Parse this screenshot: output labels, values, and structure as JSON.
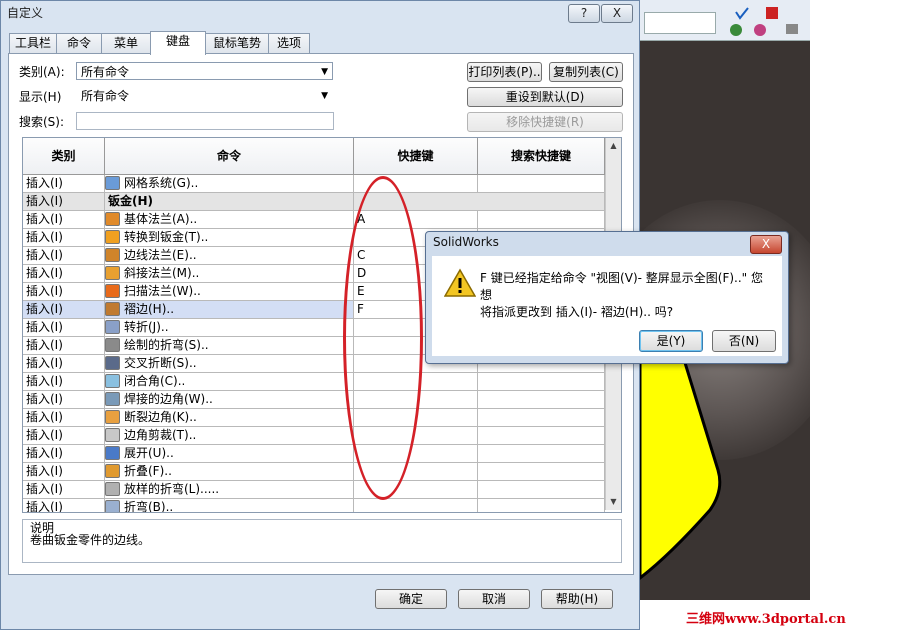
{
  "dialog": {
    "title": "自定义",
    "help_button": "?",
    "close_button": "X",
    "tabs": [
      {
        "label": "工具栏"
      },
      {
        "label": "命令"
      },
      {
        "label": "菜单"
      },
      {
        "label": "键盘"
      },
      {
        "label": "鼠标笔势"
      },
      {
        "label": "选项"
      }
    ],
    "active_tab": "键盘",
    "category_label": "类别(A):",
    "category_value": "所有命令",
    "show_label": "显示(H)",
    "show_value": "所有命令",
    "search_label": "搜索(S):",
    "search_value": "",
    "print_list_button": "打印列表(P)..",
    "copy_list_button": "复制列表(C)",
    "reset_default_button": "重设到默认(D)",
    "remove_shortcut_button": "移除快捷键(R)",
    "columns": [
      "类别",
      "命令",
      "快捷键",
      "搜索快捷键"
    ],
    "rows": [
      {
        "category": "插入(I)",
        "command": "网格系统(G)..",
        "shortcut": "",
        "group": false
      },
      {
        "category": "插入(I)",
        "command": "钣金(H)",
        "shortcut": "",
        "group": true
      },
      {
        "category": "插入(I)",
        "command": "基体法兰(A)..",
        "shortcut": "A",
        "group": false
      },
      {
        "category": "插入(I)",
        "command": "转换到钣金(T)..",
        "shortcut": "",
        "group": false
      },
      {
        "category": "插入(I)",
        "command": "边线法兰(E)..",
        "shortcut": "C",
        "group": false
      },
      {
        "category": "插入(I)",
        "command": "斜接法兰(M)..",
        "shortcut": "D",
        "group": false
      },
      {
        "category": "插入(I)",
        "command": "扫描法兰(W)..",
        "shortcut": "E",
        "group": false
      },
      {
        "category": "插入(I)",
        "command": "褶边(H)..",
        "shortcut": "F",
        "group": false,
        "selected": true
      },
      {
        "category": "插入(I)",
        "command": "转折(J)..",
        "shortcut": "",
        "group": false
      },
      {
        "category": "插入(I)",
        "command": "绘制的折弯(S)..",
        "shortcut": "",
        "group": false
      },
      {
        "category": "插入(I)",
        "command": "交叉折断(S)..",
        "shortcut": "",
        "group": false
      },
      {
        "category": "插入(I)",
        "command": "闭合角(C)..",
        "shortcut": "",
        "group": false
      },
      {
        "category": "插入(I)",
        "command": "焊接的边角(W)..",
        "shortcut": "",
        "group": false
      },
      {
        "category": "插入(I)",
        "command": "断裂边角(K)..",
        "shortcut": "",
        "group": false
      },
      {
        "category": "插入(I)",
        "command": "边角剪裁(T)..",
        "shortcut": "",
        "group": false
      },
      {
        "category": "插入(I)",
        "command": "展开(U)..",
        "shortcut": "",
        "group": false
      },
      {
        "category": "插入(I)",
        "command": "折叠(F)..",
        "shortcut": "",
        "group": false
      },
      {
        "category": "插入(I)",
        "command": "放样的折弯(L).....",
        "shortcut": "",
        "group": false
      },
      {
        "category": "插入(I)",
        "command": "折弯(B)..",
        "shortcut": "",
        "group": false
      }
    ],
    "description_label": "说明",
    "description_text": "卷曲钣金零件的边线。",
    "ok_button": "确定",
    "cancel_button": "取消",
    "help_dialog_button": "帮助(H)"
  },
  "message_box": {
    "title": "SolidWorks",
    "close_button": "X",
    "line1": "F 键已经指定给命令 \"视图(V)- 整屏显示全图(F)..\" 您想",
    "line2": "将指派更改到 插入(I)- 褶边(H).. 吗?",
    "yes_button": "是(Y)",
    "no_button": "否(N)"
  },
  "watermark": "三维网www.3dportal.cn",
  "colors": {
    "annotation_red": "#d42128",
    "selected_row": "#d3def5",
    "cad_yellow": "#ffff00"
  }
}
